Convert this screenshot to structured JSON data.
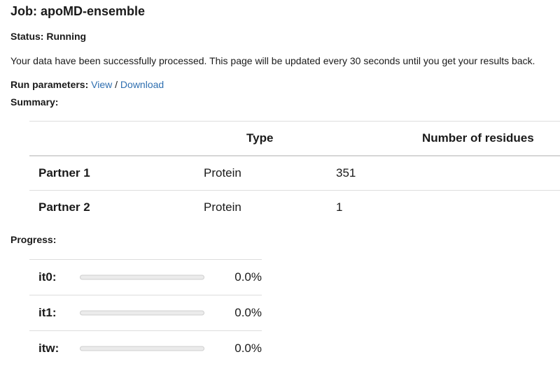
{
  "job": {
    "title": "Job: apoMD-ensemble",
    "status": "Status: Running",
    "message": "Your data have been successfully processed. This page will be updated every 30 seconds until you get your results back."
  },
  "run_parameters": {
    "label": "Run parameters:",
    "view_label": "View",
    "separator": "/",
    "download_label": "Download",
    "link_color": "#2f6fb0"
  },
  "summary": {
    "label": "Summary:",
    "headers": [
      "",
      "Type",
      "Number of residues"
    ],
    "rows": [
      {
        "name": "Partner 1",
        "type": "Protein",
        "residues": "351"
      },
      {
        "name": "Partner 2",
        "type": "Protein",
        "residues": "1"
      }
    ]
  },
  "progress": {
    "label": "Progress:",
    "bar_color": "#4a90d9",
    "items": [
      {
        "name": "it0:",
        "value": 0.0,
        "percent_text": "0.0%"
      },
      {
        "name": "it1:",
        "value": 0.0,
        "percent_text": "0.0%"
      },
      {
        "name": "itw:",
        "value": 0.0,
        "percent_text": "0.0%"
      }
    ]
  }
}
